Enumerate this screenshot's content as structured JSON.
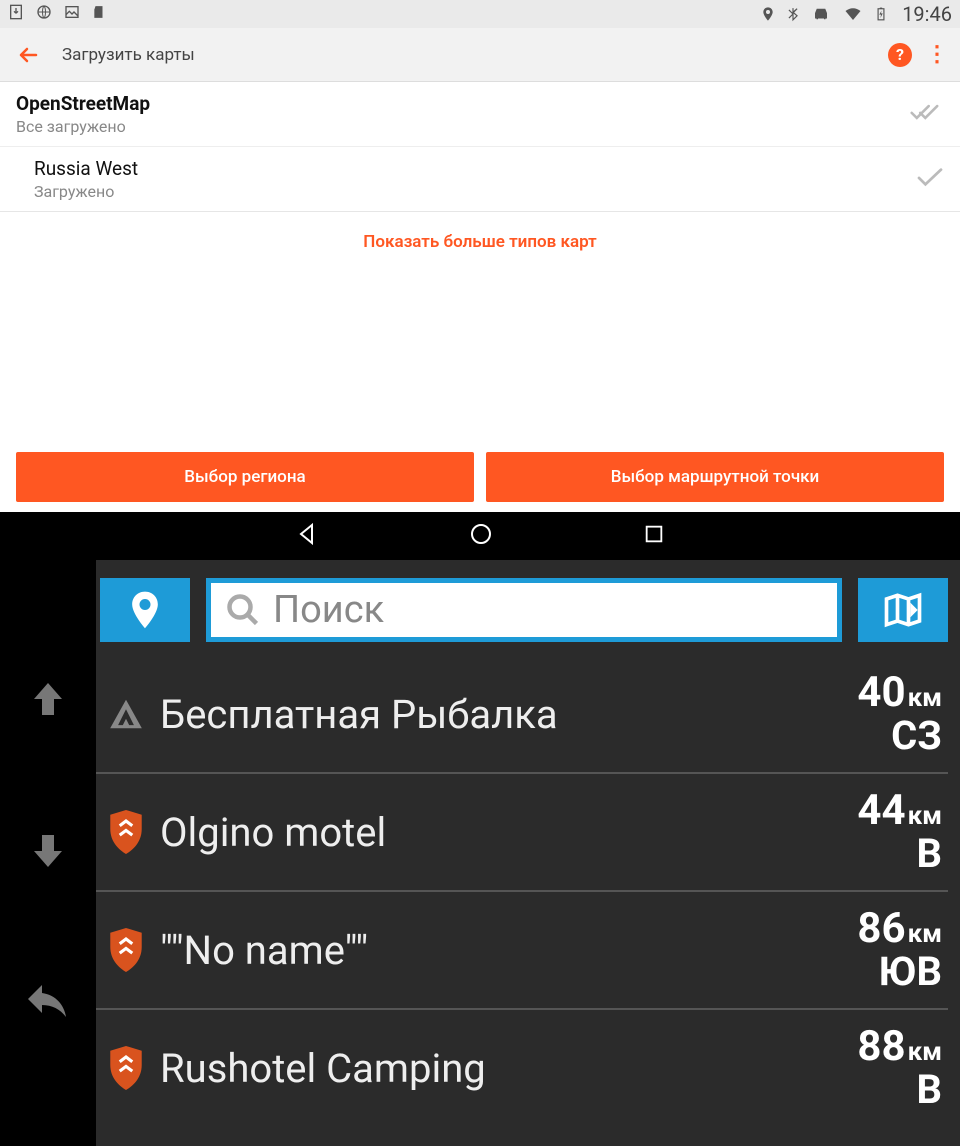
{
  "status": {
    "time": "19:46"
  },
  "appbar": {
    "title": "Загрузить карты"
  },
  "downloads": {
    "group_title": "OpenStreetMap",
    "group_sub": "Все загружено",
    "child_title": "Russia West",
    "child_sub": "Загружено"
  },
  "more_types": "Показать больше типов карт",
  "buttons": {
    "region": "Выбор региона",
    "waypoint": "Выбор маршрутной точки"
  },
  "search": {
    "placeholder": "Поиск"
  },
  "results": [
    {
      "icon": "tent",
      "name": "Бесплатная Рыбалка",
      "dist": "40",
      "unit": "км",
      "dir": "СЗ"
    },
    {
      "icon": "shield",
      "name": "Olgino motel",
      "dist": "44",
      "unit": "км",
      "dir": "В"
    },
    {
      "icon": "shield",
      "name": "\"\"No name\"\"",
      "dist": "86",
      "unit": "км",
      "dir": "ЮВ"
    },
    {
      "icon": "shield",
      "name": "Rushotel Camping",
      "dist": "88",
      "unit": "км",
      "dir": "В"
    }
  ]
}
